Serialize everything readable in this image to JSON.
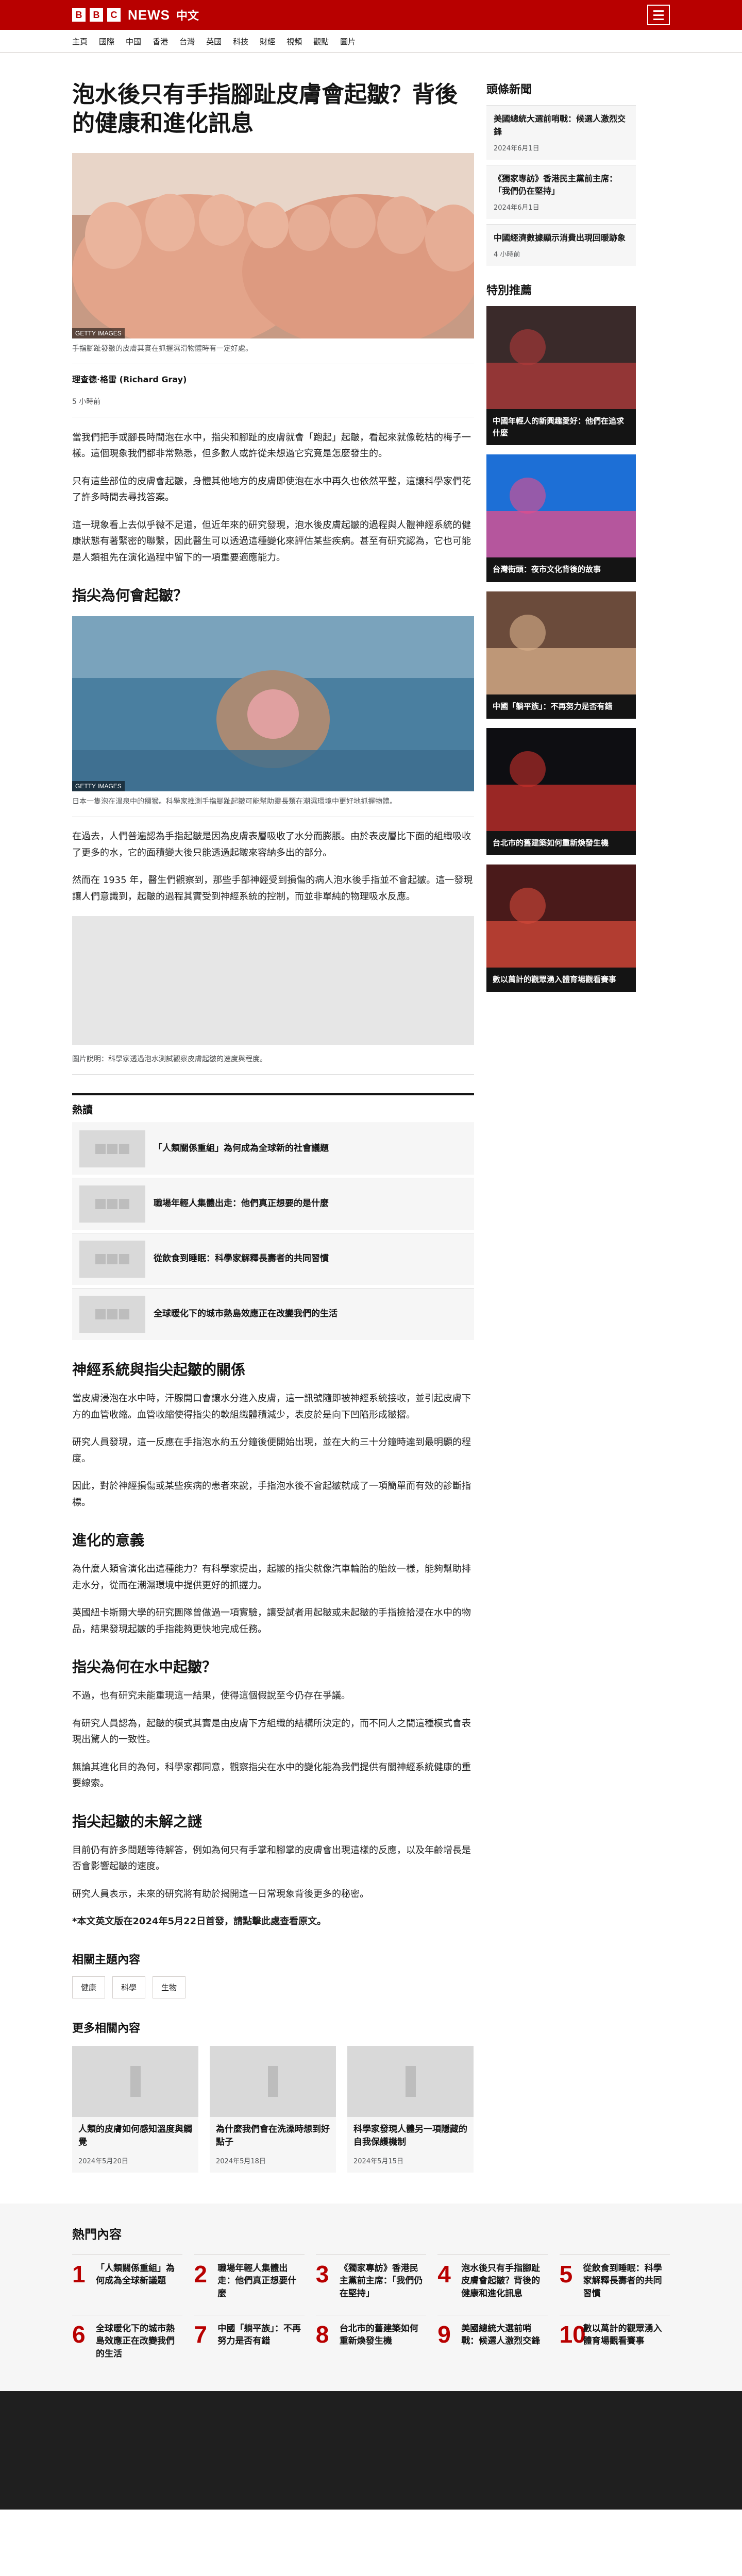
{
  "header": {
    "brand_logo": "BBC",
    "brand_name": "NEWS",
    "brand_sub": "中文",
    "menu_icon": "hamburger-icon"
  },
  "nav": {
    "items": [
      "主頁",
      "國際",
      "中國",
      "香港",
      "台灣",
      "英國",
      "科技",
      "財經",
      "視頻",
      "觀點",
      "圖片"
    ]
  },
  "article": {
    "headline": "泡水後只有手指腳趾皮膚會起皺？背後的健康和進化訊息",
    "hero_credit": "GETTY IMAGES",
    "hero_caption": "手指腳趾發皺的皮膚其實在抓握濕滑物體時有一定好處。",
    "byline_name": "理查德·格雷 (Richard Gray)",
    "byline_role": "",
    "date": "5 小時前",
    "paragraphs_a": [
      "當我們把手或腳長時間泡在水中，指尖和腳趾的皮膚就會「跑起」起皺，看起來就像乾枯的梅子一樣。這個現象我們都非常熟悉，但多數人或許從未想過它究竟是怎麼發生的。",
      "只有這些部位的皮膚會起皺，身體其他地方的皮膚即使泡在水中再久也依然平整，這讓科學家們花了許多時間去尋找答案。",
      "這一現象看上去似乎微不足道，但近年來的研究發現，泡水後皮膚起皺的過程與人體神經系統的健康狀態有著緊密的聯繫，因此醫生可以透過這種變化來評估某些疾病。甚至有研究認為，它也可能是人類祖先在演化過程中留下的一項重要適應能力。"
    ],
    "h2_1": "指尖為何會起皺？",
    "img2_credit": "GETTY IMAGES",
    "img2_caption": "日本一隻泡在溫泉中的獼猴。科學家推測手指腳趾起皺可能幫助靈長類在潮濕環境中更好地抓握物體。",
    "paragraphs_b": [
      "在過去，人們普遍認為手指起皺是因為皮膚表層吸收了水分而膨脹。由於表皮層比下面的組織吸收了更多的水，它的面積變大後只能透過起皺來容納多出的部分。",
      "然而在 1935 年，醫生們觀察到，那些手部神經受到損傷的病人泡水後手指並不會起皺。這一發現讓人們意識到，起皺的過程其實受到神經系統的控制，而並非單純的物理吸水反應。"
    ],
    "gray_caption": "圖片說明：科學家透過泡水測試觀察皮膚起皺的速度與程度。",
    "hot_title": "熱讀",
    "hot_items": [
      "「人類關係重組」為何成為全球新的社會議題",
      "職場年輕人集體出走：他們真正想要的是什麼",
      "從飲食到睡眠：科學家解釋長壽者的共同習慣",
      "全球暖化下的城市熱島效應正在改變我們的生活"
    ],
    "h2_2": "神經系統與指尖起皺的關係",
    "paragraphs_c": [
      "當皮膚浸泡在水中時，汗腺開口會讓水分進入皮膚，這一訊號隨即被神經系統接收，並引起皮膚下方的血管收縮。血管收縮使得指尖的軟組織體積減少，表皮於是向下凹陷形成皺摺。",
      "研究人員發現，這一反應在手指泡水約五分鐘後便開始出現，並在大約三十分鐘時達到最明顯的程度。",
      "因此，對於神經損傷或某些疾病的患者來說，手指泡水後不會起皺就成了一項簡單而有效的診斷指標。"
    ],
    "h2_3": "進化的意義",
    "paragraphs_d": [
      "為什麼人類會演化出這種能力？有科學家提出，起皺的指尖就像汽車輪胎的胎紋一樣，能夠幫助排走水分，從而在潮濕環境中提供更好的抓握力。",
      "英國紐卡斯爾大學的研究團隊曾做過一項實驗，讓受試者用起皺或未起皺的手指撿拾浸在水中的物品，結果發現起皺的手指能夠更快地完成任務。"
    ],
    "h2_4": "指尖為何在水中起皺？",
    "paragraphs_e": [
      "不過，也有研究未能重現這一結果，使得這個假說至今仍存在爭議。",
      "有研究人員認為，起皺的模式其實是由皮膚下方組織的結構所決定的，而不同人之間這種模式會表現出驚人的一致性。",
      "無論其進化目的為何，科學家都同意，觀察指尖在水中的變化能為我們提供有關神經系統健康的重要線索。"
    ],
    "h2_5": "指尖起皺的未解之謎",
    "paragraphs_f": [
      "目前仍有許多問題等待解答，例如為何只有手掌和腳掌的皮膚會出現這樣的反應，以及年齡增長是否會影響起皺的速度。",
      "研究人員表示，未來的研究將有助於揭開這一日常現象背後更多的秘密。"
    ],
    "footnote": "*本文英文版在2024年5月22日首發，請點擊此處查看原文。"
  },
  "related": {
    "title": "相關主題內容",
    "tags": [
      "健康",
      "科學",
      "生物"
    ],
    "more_title": "更多相關內容",
    "more_items": [
      {
        "title": "人類的皮膚如何感知溫度與觸覺",
        "date": "2024年5月20日"
      },
      {
        "title": "為什麼我們會在洗澡時想到好點子",
        "date": "2024年5月18日"
      },
      {
        "title": "科學家發現人體另一項隱藏的自我保護機制",
        "date": "2024年5月15日"
      }
    ]
  },
  "sidebar": {
    "news_title": "頭條新聞",
    "news": [
      {
        "title": "美國總統大選前哨戰：候選人激烈交鋒",
        "date": "2024年6月1日"
      },
      {
        "title": "《獨家專訪》香港民主黨前主席：「我們仍在堅持」",
        "date": "2024年6月1日"
      },
      {
        "title": "中國經濟數據顯示消費出現回暖跡象",
        "date": "4 小時前"
      }
    ],
    "feature_title": "特別推薦",
    "features": [
      "中國年輕人的新興趣愛好：他們在追求什麼",
      "台灣街頭：夜市文化背後的故事",
      "中國「躺平族」：不再努力是否有錯",
      "台北市的舊建築如何重新煥發生機",
      "數以萬計的觀眾湧入體育場觀看賽事"
    ]
  },
  "popular": {
    "title": "熱門內容",
    "items": [
      "「人類關係重組」為何成為全球新議題",
      "職場年輕人集體出走：他們真正想要什麼",
      "《獨家專訪》香港民主黨前主席：「我們仍在堅持」",
      "泡水後只有手指腳趾皮膚會起皺？背後的健康和進化訊息",
      "從飲食到睡眠：科學家解釋長壽者的共同習慣",
      "全球暖化下的城市熱島效應正在改變我們的生活",
      "中國「躺平族」：不再努力是否有錯",
      "台北市的舊建築如何重新煥發生機",
      "美國總統大選前哨戰：候選人激烈交鋒",
      "數以萬計的觀眾湧入體育場觀看賽事"
    ],
    "numbers": [
      "1",
      "2",
      "3",
      "4",
      "5",
      "6",
      "7",
      "8",
      "9",
      "10"
    ]
  },
  "colors": {
    "brand_red": "#b80000",
    "text": "#141414",
    "muted": "#545658"
  }
}
